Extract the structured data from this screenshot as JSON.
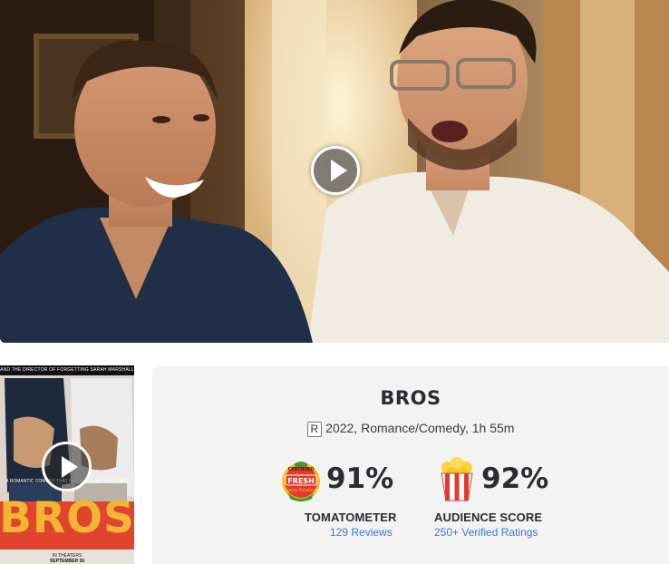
{
  "hero": {
    "play_icon": "play-icon"
  },
  "poster": {
    "credit_line": "AND THE DIRECTOR OF FORGETTING SARAH MARSHALL",
    "tagline": "A ROMANTIC COMEDY THAT GIVES YOU ALL THE FEELS",
    "title_art": "BROS",
    "release_line1": "IN THEATERS",
    "release_line2": "SEPTEMBER 30",
    "play_icon": "play-icon"
  },
  "movie": {
    "title": "BROS",
    "rating": "R",
    "details": "2022, Romance/Comedy, 1h 55m"
  },
  "tomatometer": {
    "icon": "certified-fresh-icon",
    "badge_top": "CERTIFIED",
    "badge_mid": "FRESH",
    "badge_bottom": "Rotten Tomatoes",
    "score": "91%",
    "label": "TOMATOMETER",
    "link": "129 Reviews"
  },
  "audience": {
    "icon": "popcorn-icon",
    "score": "92%",
    "label": "AUDIENCE SCORE",
    "link": "250+ Verified Ratings"
  },
  "colors": {
    "link": "#3976dc",
    "fresh_red": "#e23b2e",
    "panel_bg": "#f3f3f3",
    "poster_gold": "#f2b632"
  }
}
